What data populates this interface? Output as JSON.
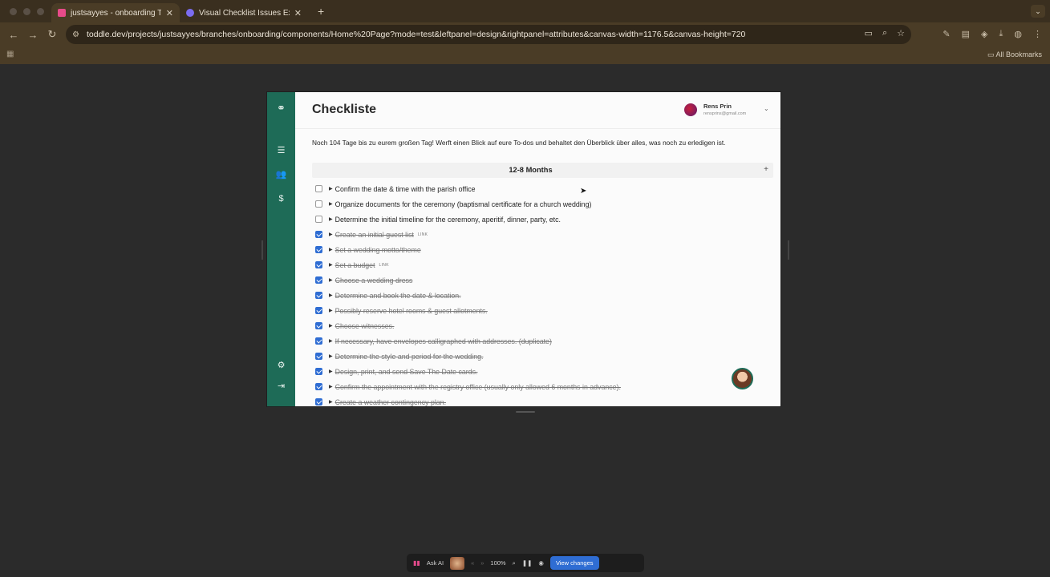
{
  "browser": {
    "tabs": [
      {
        "title": "justsayyes - onboarding Toddle",
        "active": true
      },
      {
        "title": "Visual Checklist Issues Explained",
        "active": false
      }
    ],
    "url": "toddle.dev/projects/justsayyes/branches/onboarding/components/Home%20Page?mode=test&leftpanel=design&rightpanel=attributes&canvas-width=1176.5&canvas-height=720",
    "bookmarks_label": "All Bookmarks"
  },
  "app": {
    "title": "Checkliste",
    "user": {
      "name": "Rens Prin",
      "email": "rensprins@gmail.com"
    },
    "intro": "Noch 104 Tage bis zu eurem großen Tag! Werft einen Blick auf eure To-dos und behaltet den Überblick über alles, was noch zu erledigen ist.",
    "section": {
      "title": "12-8 Months",
      "add": "+"
    },
    "items": [
      {
        "text": "Confirm the date & time with the parish office",
        "checked": false,
        "link": ""
      },
      {
        "text": "Organize documents for the ceremony (baptismal certificate for a church wedding)",
        "checked": false,
        "link": ""
      },
      {
        "text": "Determine the initial timeline for the ceremony, aperitif, dinner, party, etc.",
        "checked": false,
        "link": ""
      },
      {
        "text": "Create an initial guest list",
        "checked": true,
        "link": "LINK"
      },
      {
        "text": "Set a wedding motto/theme",
        "checked": true,
        "link": ""
      },
      {
        "text": "Set a budget",
        "checked": true,
        "link": "LINK"
      },
      {
        "text": "Choose a wedding dress",
        "checked": true,
        "link": ""
      },
      {
        "text": "Determine and book the date & location.",
        "checked": true,
        "link": ""
      },
      {
        "text": "Possibly reserve hotel rooms & guest allotments.",
        "checked": true,
        "link": ""
      },
      {
        "text": "Choose witnesses.",
        "checked": true,
        "link": ""
      },
      {
        "text": "If necessary, have envelopes calligraphed with addresses. (duplicate)",
        "checked": true,
        "link": ""
      },
      {
        "text": "Determine the style and period for the wedding.",
        "checked": true,
        "link": ""
      },
      {
        "text": "Design, print, and send Save The Date cards.",
        "checked": true,
        "link": ""
      },
      {
        "text": "Confirm the appointment with the registry office (usually only allowed 6 months in advance).",
        "checked": true,
        "link": ""
      },
      {
        "text": "Create a weather contingency plan.",
        "checked": true,
        "link": ""
      }
    ]
  },
  "bottom_bar": {
    "ask_ai": "Ask AI",
    "zoom": "100%",
    "view_changes": "View changes"
  },
  "colors": {
    "rail": "#1e6b57",
    "checkbox": "#2f6dd3",
    "browser_chrome": "#4a3c26"
  }
}
